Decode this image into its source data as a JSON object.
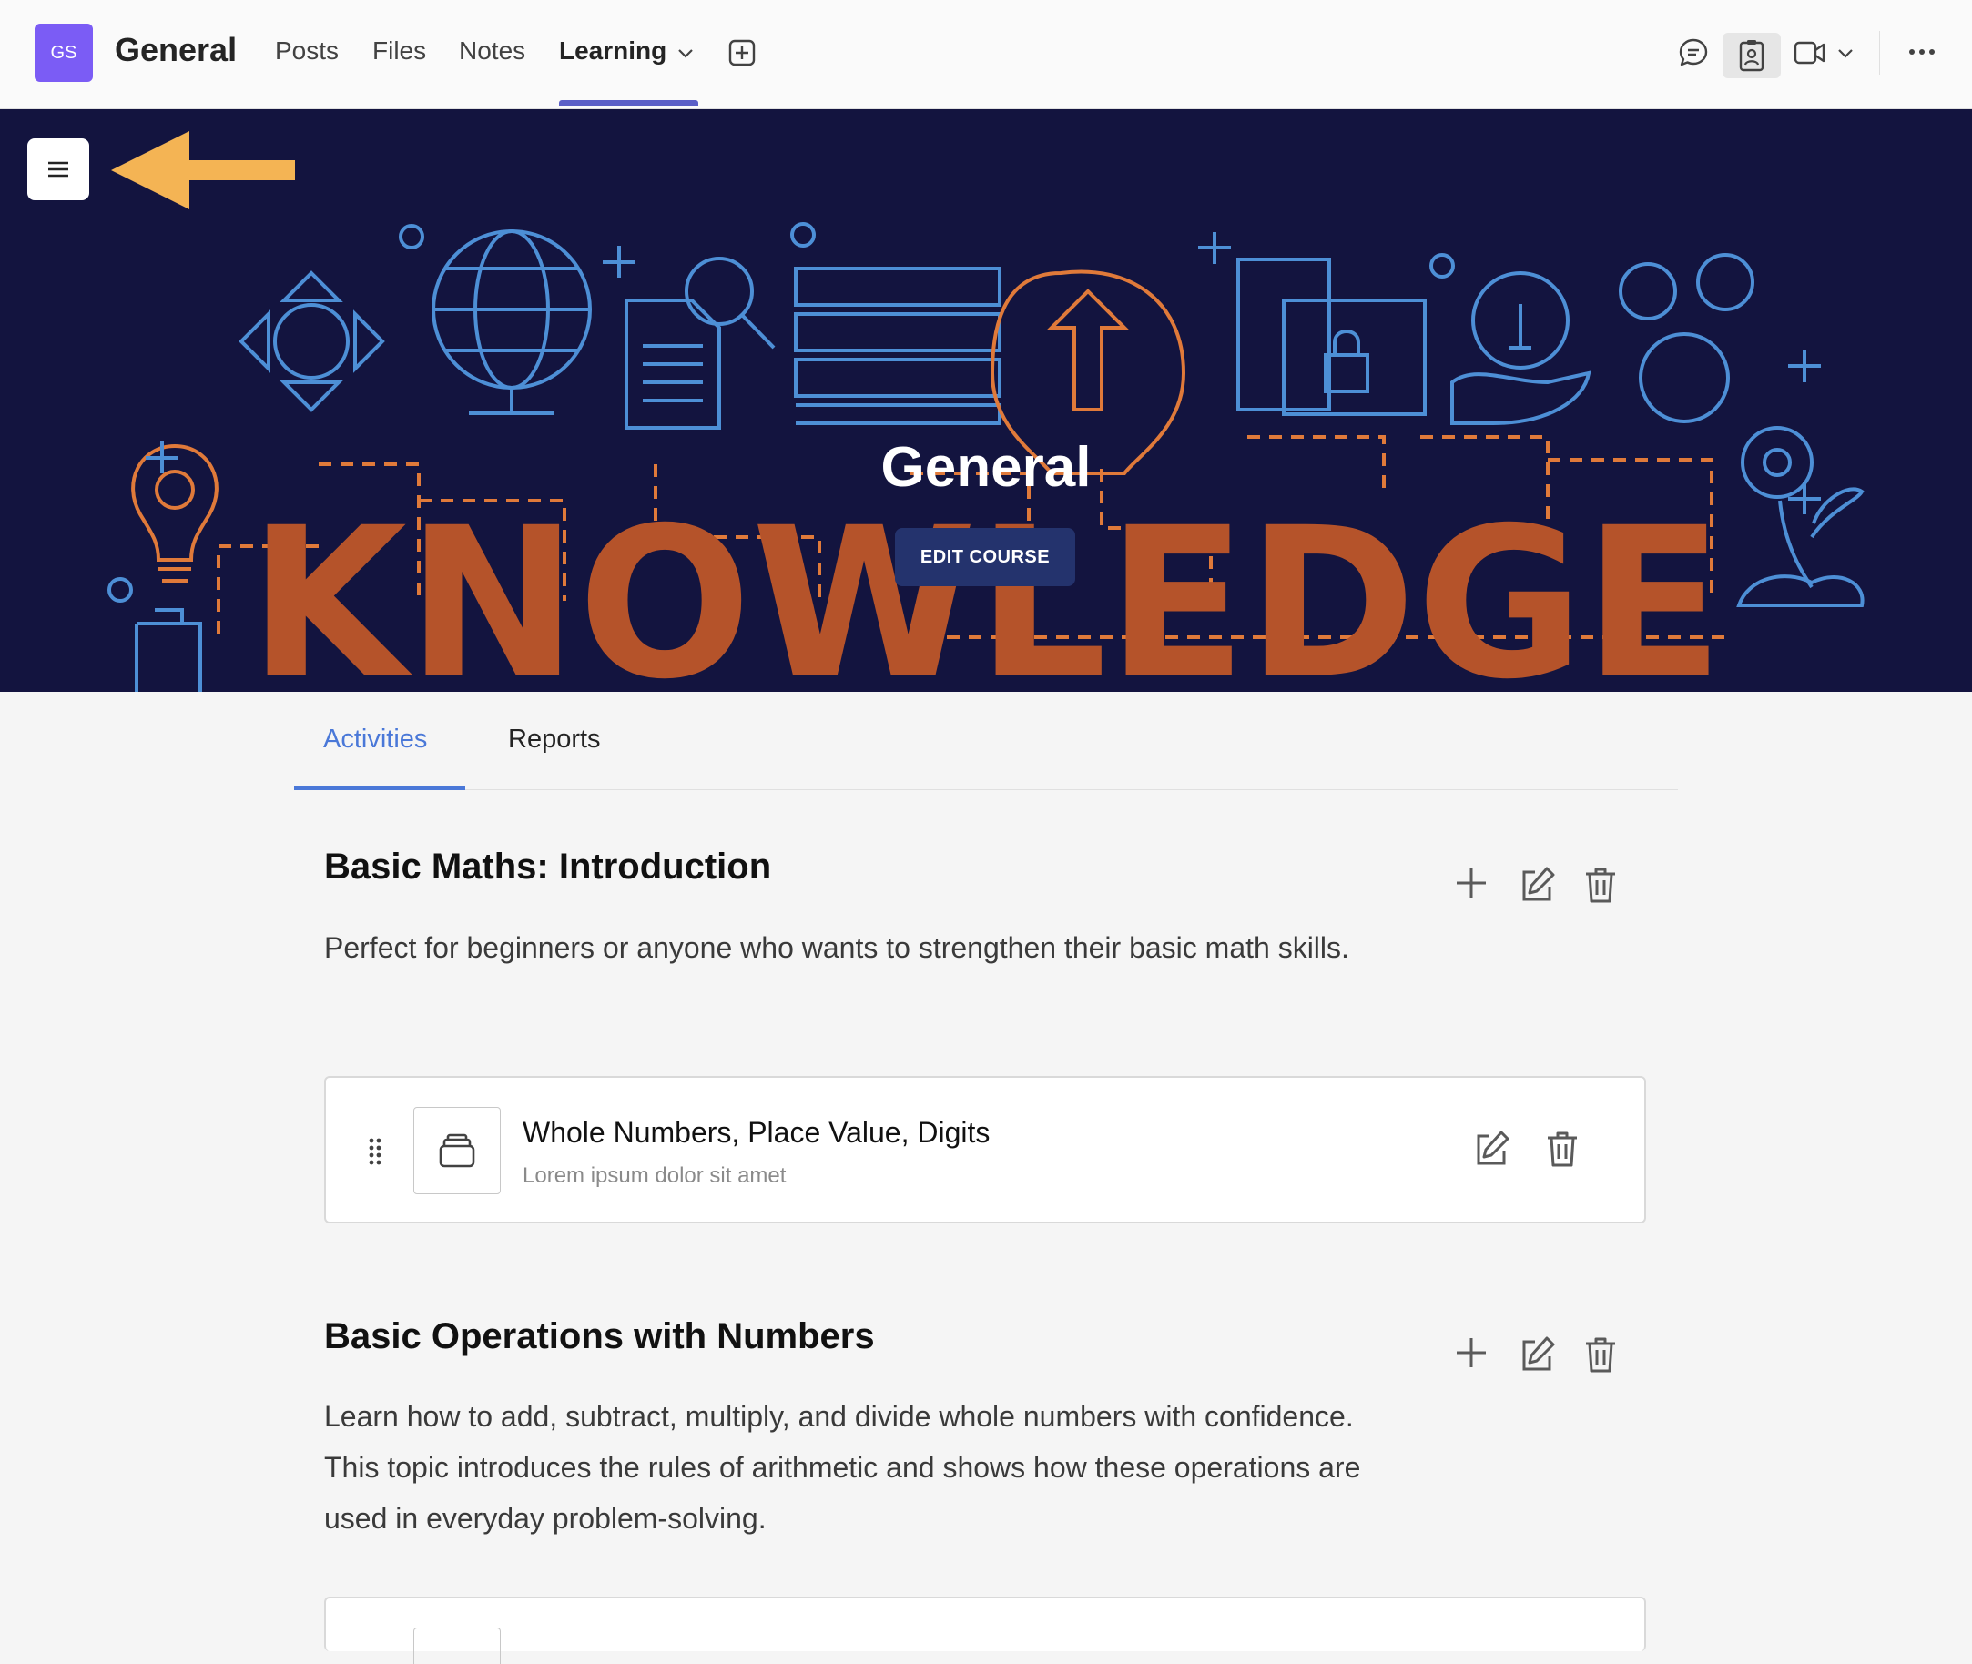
{
  "header": {
    "avatar_initials": "GS",
    "title": "General",
    "tabs": [
      {
        "label": "Posts"
      },
      {
        "label": "Files"
      },
      {
        "label": "Notes"
      },
      {
        "label": "Learning"
      }
    ],
    "icons": [
      "chat-icon",
      "badge-icon",
      "video-icon",
      "more-icon"
    ]
  },
  "banner": {
    "title": "General",
    "edit_label": "EDIT COURSE",
    "knowledge_text": "KNOWLEDGE"
  },
  "content_tabs": [
    {
      "label": "Activities"
    },
    {
      "label": "Reports"
    }
  ],
  "sections": [
    {
      "title": "Basic Maths: Introduction",
      "description": "Perfect for beginners or anyone who wants to strengthen their basic math skills.",
      "activity": {
        "title": "Whole Numbers, Place Value, Digits",
        "subtitle": "Lorem ipsum dolor sit amet"
      }
    },
    {
      "title": "Basic Operations with Numbers",
      "description": "Learn how to add, subtract, multiply, and divide whole numbers with confidence. This topic introduces the rules of arithmetic and shows how these operations are used in everyday problem-solving."
    }
  ],
  "colors": {
    "accent": "#5b5fc7",
    "avatar": "#7b5cf5",
    "banner_bg": "#13143f",
    "knowledge": "#b5532a",
    "tab_active": "#4a78d8",
    "arrow": "#f4b454"
  }
}
